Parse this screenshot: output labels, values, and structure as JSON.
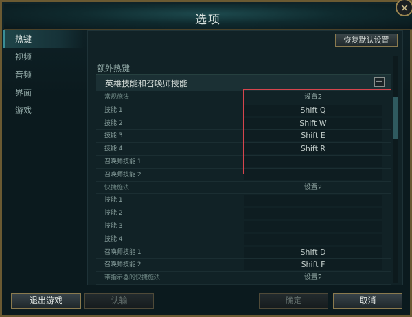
{
  "window": {
    "title": "选项",
    "close_glyph": "✕"
  },
  "sidebar": {
    "items": [
      {
        "label": "热键",
        "active": true
      },
      {
        "label": "视频",
        "active": false
      },
      {
        "label": "音频",
        "active": false
      },
      {
        "label": "界面",
        "active": false
      },
      {
        "label": "游戏",
        "active": false
      }
    ]
  },
  "toolbar": {
    "reset_label": "恢复默认设置"
  },
  "section": {
    "title": "额外热键",
    "group_title": "英雄技能和召唤师技能",
    "collapse_glyph": "—"
  },
  "table": {
    "rows": [
      {
        "label": "常规施法",
        "value": "设置2",
        "header": true
      },
      {
        "label": "技能 1",
        "value": "Shift  Q",
        "header": false
      },
      {
        "label": "技能 2",
        "value": "Shift  W",
        "header": false
      },
      {
        "label": "技能 3",
        "value": "Shift  E",
        "header": false
      },
      {
        "label": "技能 4",
        "value": "Shift  R",
        "header": false
      },
      {
        "label": "召唤师技能 1",
        "value": "",
        "header": false
      },
      {
        "label": "召唤师技能 2",
        "value": "",
        "header": false
      },
      {
        "label": "快捷施法",
        "value": "设置2",
        "header": true
      },
      {
        "label": "技能 1",
        "value": "",
        "header": false
      },
      {
        "label": "技能 2",
        "value": "",
        "header": false
      },
      {
        "label": "技能 3",
        "value": "",
        "header": false
      },
      {
        "label": "技能 4",
        "value": "",
        "header": false
      },
      {
        "label": "召唤师技能 1",
        "value": "Shift  D",
        "header": false
      },
      {
        "label": "召唤师技能 2",
        "value": "Shift  F",
        "header": false
      },
      {
        "label": "带指示器的快捷施法",
        "value": "设置2",
        "header": true
      }
    ]
  },
  "footer": {
    "exit_label": "退出游戏",
    "verify_label": "认输",
    "confirm_label": "确定",
    "cancel_label": "取消"
  },
  "colors": {
    "highlight": "#d6454d",
    "accent": "#3a8e96",
    "border_gold": "#8a7a4e"
  }
}
